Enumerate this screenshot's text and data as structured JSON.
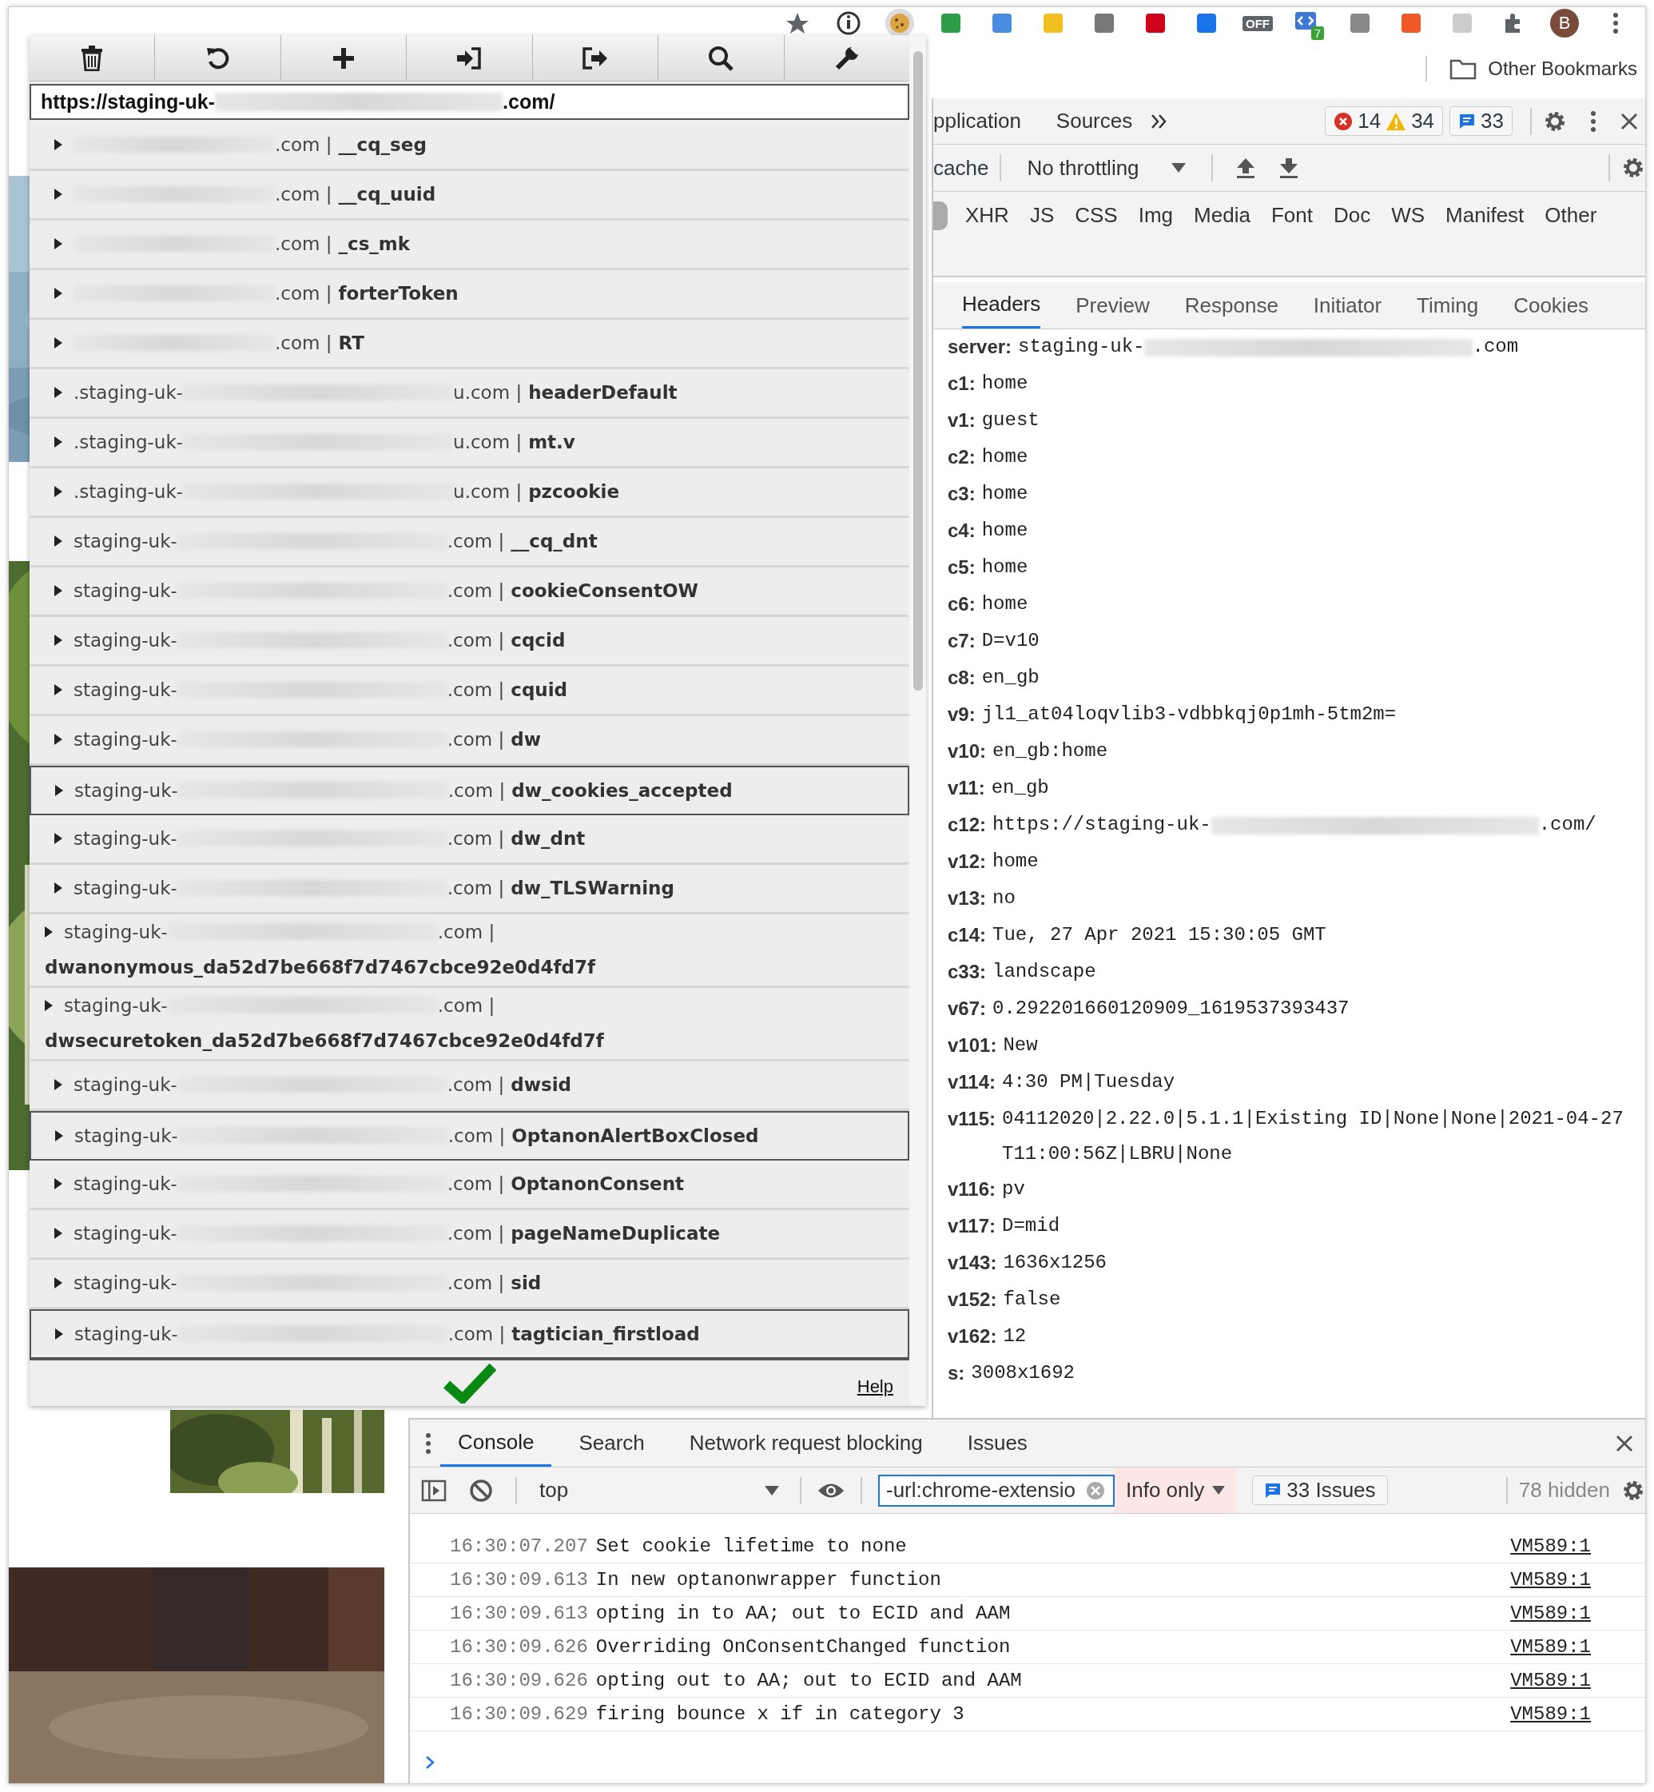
{
  "browser_toolbar": {
    "extensions": [
      {
        "kind": "star"
      },
      {
        "kind": "info"
      },
      {
        "kind": "cookie",
        "selected": true
      },
      {
        "kind": "square",
        "color": "#2e9d4a"
      },
      {
        "kind": "square",
        "color": "#4a8de0"
      },
      {
        "kind": "square",
        "color": "#f0c020"
      },
      {
        "kind": "square",
        "color": "#777777"
      },
      {
        "kind": "square",
        "color": "#d0021b"
      },
      {
        "kind": "square",
        "color": "#1a73e8"
      },
      {
        "kind": "badge",
        "badge": "OFF"
      },
      {
        "kind": "counter",
        "badge": "7"
      },
      {
        "kind": "square",
        "color": "#888888"
      },
      {
        "kind": "square",
        "color": "#f05a28"
      },
      {
        "kind": "square",
        "color": "#cccccc"
      },
      {
        "kind": "puzzle"
      },
      {
        "kind": "avatar",
        "badge": "B"
      },
      {
        "kind": "menu"
      }
    ]
  },
  "bookmarks_bar": {
    "other_bookmarks": "Other Bookmarks"
  },
  "cookie_editor": {
    "toolbar": [
      {
        "kind": "delete"
      },
      {
        "kind": "undo"
      },
      {
        "kind": "add"
      },
      {
        "kind": "import"
      },
      {
        "kind": "export"
      },
      {
        "kind": "search"
      },
      {
        "kind": "settings"
      }
    ],
    "url": "https://staging-uk-",
    "url_end": ".com/",
    "cookies": [
      {
        "domain_end": ".com |",
        "name": "__cq_seg",
        "highlighted": false,
        "wrapped": false
      },
      {
        "domain_end": ".com |",
        "name": "__cq_uuid",
        "highlighted": false,
        "wrapped": false
      },
      {
        "domain_end": ".com |",
        "name": "_cs_mk",
        "highlighted": false,
        "wrapped": false
      },
      {
        "domain_end": ".com |",
        "name": "forterToken",
        "highlighted": false,
        "wrapped": false
      },
      {
        "domain_end": ".com |",
        "name": "RT",
        "highlighted": false,
        "wrapped": false
      },
      {
        "domain": ".staging-uk-",
        "domain_end": "u.com |",
        "name": "headerDefault",
        "highlighted": false,
        "wrapped": false
      },
      {
        "domain": ".staging-uk-",
        "domain_end": "u.com |",
        "name": "mt.v",
        "highlighted": false,
        "wrapped": false
      },
      {
        "domain": ".staging-uk-",
        "domain_end": "u.com |",
        "name": "pzcookie",
        "highlighted": false,
        "wrapped": false
      },
      {
        "domain": "staging-uk-",
        "domain_end": ".com |",
        "name": "__cq_dnt",
        "highlighted": false,
        "wrapped": false
      },
      {
        "domain": "staging-uk-",
        "domain_end": ".com |",
        "name": "cookieConsentOW",
        "highlighted": false,
        "wrapped": false
      },
      {
        "domain": "staging-uk-",
        "domain_end": ".com |",
        "name": "cqcid",
        "highlighted": false,
        "wrapped": false
      },
      {
        "domain": "staging-uk-",
        "domain_end": ".com |",
        "name": "cquid",
        "highlighted": false,
        "wrapped": false
      },
      {
        "domain": "staging-uk-",
        "domain_end": ".com |",
        "name": "dw",
        "highlighted": false,
        "wrapped": false
      },
      {
        "domain": "staging-uk-",
        "domain_end": ".com |",
        "name": "dw_cookies_accepted",
        "highlighted": true,
        "wrapped": false
      },
      {
        "domain": "staging-uk-",
        "domain_end": ".com |",
        "name": "dw_dnt",
        "highlighted": false,
        "wrapped": false
      },
      {
        "domain": "staging-uk-",
        "domain_end": ".com |",
        "name": "dw_TLSWarning",
        "highlighted": false,
        "wrapped": false
      },
      {
        "domain": "staging-uk-",
        "domain_end": ".com |",
        "name": "dwanonymous_da52d7be668f7d7467cbce92e0d4fd7f",
        "highlighted": false,
        "wrapped": true
      },
      {
        "domain": "staging-uk-",
        "domain_end": ".com |",
        "name": "dwsecuretoken_da52d7be668f7d7467cbce92e0d4fd7f",
        "highlighted": false,
        "wrapped": true
      },
      {
        "domain": "staging-uk-",
        "domain_end": ".com |",
        "name": "dwsid",
        "highlighted": false,
        "wrapped": false
      },
      {
        "domain": "staging-uk-",
        "domain_end": ".com |",
        "name": "OptanonAlertBoxClosed",
        "highlighted": true,
        "wrapped": false
      },
      {
        "domain": "staging-uk-",
        "domain_end": ".com |",
        "name": "OptanonConsent",
        "highlighted": false,
        "wrapped": false
      },
      {
        "domain": "staging-uk-",
        "domain_end": ".com |",
        "name": "pageNameDuplicate",
        "highlighted": false,
        "wrapped": false
      },
      {
        "domain": "staging-uk-",
        "domain_end": ".com |",
        "name": "sid",
        "highlighted": false,
        "wrapped": false
      },
      {
        "domain": "staging-uk-",
        "domain_end": ".com |",
        "name": "tagtician_firstload",
        "highlighted": true,
        "wrapped": false
      }
    ],
    "help": "Help"
  },
  "devtools": {
    "tabs": [
      {
        "label": "pplication",
        "selected": false
      },
      {
        "label": "Sources",
        "selected": false
      }
    ],
    "errors": "14",
    "warnings": "34",
    "messages": "33",
    "network_toolbar": {
      "cache_label": "cache",
      "throttling": "No throttling"
    },
    "filter_types": [
      {
        "label": "XHR",
        "selected": false
      },
      {
        "label": "JS",
        "selected": false
      },
      {
        "label": "CSS",
        "selected": false
      },
      {
        "label": "Img",
        "selected": false
      },
      {
        "label": "Media",
        "selected": false
      },
      {
        "label": "Font",
        "selected": false
      },
      {
        "label": "Doc",
        "selected": false
      },
      {
        "label": "WS",
        "selected": false
      },
      {
        "label": "Manifest",
        "selected": false
      },
      {
        "label": "Other",
        "selected": false
      }
    ],
    "detail_tabs": [
      {
        "label": "Headers",
        "selected": true
      },
      {
        "label": "Preview",
        "selected": false
      },
      {
        "label": "Response",
        "selected": false
      },
      {
        "label": "Initiator",
        "selected": false
      },
      {
        "label": "Timing",
        "selected": false
      },
      {
        "label": "Cookies",
        "selected": false
      }
    ],
    "headers": [
      {
        "key": "server:",
        "value": "staging-uk-",
        "redacted": true,
        "value_end": ".com"
      },
      {
        "key": "c1:",
        "value": "home",
        "redacted": false
      },
      {
        "key": "v1:",
        "value": "guest",
        "redacted": false
      },
      {
        "key": "c2:",
        "value": "home",
        "redacted": false
      },
      {
        "key": "c3:",
        "value": "home",
        "redacted": false
      },
      {
        "key": "c4:",
        "value": "home",
        "redacted": false
      },
      {
        "key": "c5:",
        "value": "home",
        "redacted": false
      },
      {
        "key": "c6:",
        "value": "home",
        "redacted": false
      },
      {
        "key": "c7:",
        "value": "D=v10",
        "redacted": false
      },
      {
        "key": "c8:",
        "value": "en_gb",
        "redacted": false
      },
      {
        "key": "v9:",
        "value": "jl1_at04loqvlib3-vdbbkqj0p1mh-5tm2m=",
        "redacted": false
      },
      {
        "key": "v10:",
        "value": "en_gb:home",
        "redacted": false
      },
      {
        "key": "v11:",
        "value": "en_gb",
        "redacted": false
      },
      {
        "key": "c12:",
        "value": "https://staging-uk-",
        "redacted": true,
        "value_end": ".com/"
      },
      {
        "key": "v12:",
        "value": "home",
        "redacted": false
      },
      {
        "key": "v13:",
        "value": "no",
        "redacted": false
      },
      {
        "key": "c14:",
        "value": "Tue, 27 Apr 2021 15:30:05 GMT",
        "redacted": false
      },
      {
        "key": "c33:",
        "value": "landscape",
        "redacted": false
      },
      {
        "key": "v67:",
        "value": "0.292201660120909_1619537393437",
        "redacted": false
      },
      {
        "key": "v101:",
        "value": "New",
        "redacted": false
      },
      {
        "key": "v114:",
        "value": "4:30 PM|Tuesday",
        "redacted": false
      },
      {
        "key": "v115:",
        "value": "04112020|2.22.0|5.1.1|Existing ID|None|None|2021-04-27T11:00:56Z|LBRU|None",
        "redacted": false
      },
      {
        "key": "v116:",
        "value": "pv",
        "redacted": false
      },
      {
        "key": "v117:",
        "value": "D=mid",
        "redacted": false
      },
      {
        "key": "v143:",
        "value": "1636x1256",
        "redacted": false
      },
      {
        "key": "v152:",
        "value": "false",
        "redacted": false
      },
      {
        "key": "v162:",
        "value": "12",
        "redacted": false
      },
      {
        "key": "s:",
        "value": "3008x1692",
        "redacted": false
      }
    ]
  },
  "console_drawer": {
    "tabs": [
      {
        "label": "Console",
        "selected": true
      },
      {
        "label": "Search",
        "selected": false
      },
      {
        "label": "Network request blocking",
        "selected": false
      },
      {
        "label": "Issues",
        "selected": false
      }
    ],
    "context": "top",
    "filter": "-url:chrome-extensio",
    "levels": "Info only",
    "issues": "33 Issues",
    "hidden": "78 hidden",
    "logs": [
      {
        "time": "16:30:07.207",
        "message": "Set cookie lifetime to none",
        "source": "VM589:1"
      },
      {
        "time": "16:30:09.613",
        "message": "In new optanonwrapper function",
        "source": "VM589:1"
      },
      {
        "time": "16:30:09.613",
        "message": "opting in to AA; out to ECID and AAM",
        "source": "VM589:1"
      },
      {
        "time": "16:30:09.626",
        "message": "Overriding OnConsentChanged function",
        "source": "VM589:1"
      },
      {
        "time": "16:30:09.626",
        "message": "opting out to AA; out to ECID and AAM",
        "source": "VM589:1"
      },
      {
        "time": "16:30:09.629",
        "message": "firing bounce x if in category 3",
        "source": "VM589:1"
      }
    ]
  }
}
